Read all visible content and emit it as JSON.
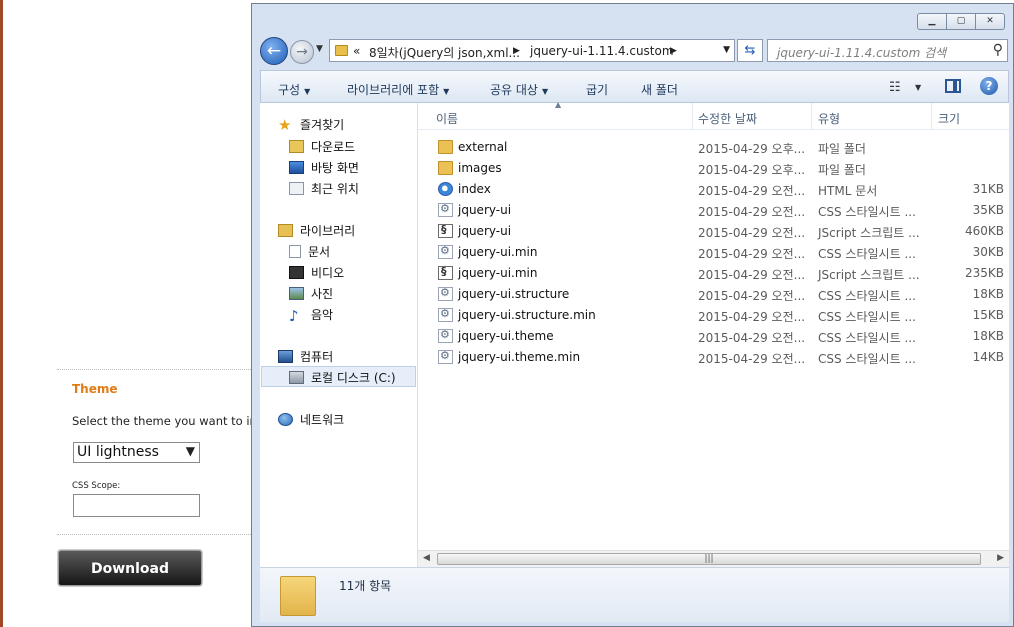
{
  "page": {
    "theme_heading": "Theme",
    "theme_text": "Select the theme you want to inc",
    "theme_selected": "UI lightness",
    "scope_label": "CSS Scope:",
    "download_label": "Download"
  },
  "window": {
    "address": {
      "overflow": "«",
      "crumb1": "8일차(jQuery의 json,xml...",
      "crumb2": "jquery-ui-1.11.4.custom"
    },
    "search_placeholder": "jquery-ui-1.11.4.custom 검색",
    "commands": [
      "구성",
      "라이브러리에 포함",
      "공유 대상",
      "굽기",
      "새 폴더"
    ],
    "nav": {
      "favorites": "즐겨찾기",
      "downloads": "다운로드",
      "desktop": "바탕 화면",
      "recent": "최근 위치",
      "libraries": "라이브러리",
      "documents": "문서",
      "videos": "비디오",
      "pictures": "사진",
      "music": "음악",
      "computer": "컴퓨터",
      "local_disk": "로컬 디스크 (C:)",
      "network": "네트워크"
    },
    "columns": {
      "name": "이름",
      "date": "수정한 날짜",
      "type": "유형",
      "size": "크기"
    },
    "files": [
      {
        "name": "external",
        "date": "2015-04-29 오후...",
        "type": "파일 폴더",
        "size": "",
        "icon": "folder-icon"
      },
      {
        "name": "images",
        "date": "2015-04-29 오후...",
        "type": "파일 폴더",
        "size": "",
        "icon": "folder-icon"
      },
      {
        "name": "index",
        "date": "2015-04-29 오전...",
        "type": "HTML 문서",
        "size": "31KB",
        "icon": "html-file-icon"
      },
      {
        "name": "jquery-ui",
        "date": "2015-04-29 오전...",
        "type": "CSS 스타일시트 ...",
        "size": "35KB",
        "icon": "css-file-icon"
      },
      {
        "name": "jquery-ui",
        "date": "2015-04-29 오전...",
        "type": "JScript 스크립트 ...",
        "size": "460KB",
        "icon": "js-file-icon"
      },
      {
        "name": "jquery-ui.min",
        "date": "2015-04-29 오전...",
        "type": "CSS 스타일시트 ...",
        "size": "30KB",
        "icon": "css-file-icon"
      },
      {
        "name": "jquery-ui.min",
        "date": "2015-04-29 오전...",
        "type": "JScript 스크립트 ...",
        "size": "235KB",
        "icon": "js-file-icon"
      },
      {
        "name": "jquery-ui.structure",
        "date": "2015-04-29 오전...",
        "type": "CSS 스타일시트 ...",
        "size": "18KB",
        "icon": "css-file-icon"
      },
      {
        "name": "jquery-ui.structure.min",
        "date": "2015-04-29 오전...",
        "type": "CSS 스타일시트 ...",
        "size": "15KB",
        "icon": "css-file-icon"
      },
      {
        "name": "jquery-ui.theme",
        "date": "2015-04-29 오전...",
        "type": "CSS 스타일시트 ...",
        "size": "18KB",
        "icon": "css-file-icon"
      },
      {
        "name": "jquery-ui.theme.min",
        "date": "2015-04-29 오전...",
        "type": "CSS 스타일시트 ...",
        "size": "14KB",
        "icon": "css-file-icon"
      }
    ],
    "item_count": "11개 항목"
  }
}
